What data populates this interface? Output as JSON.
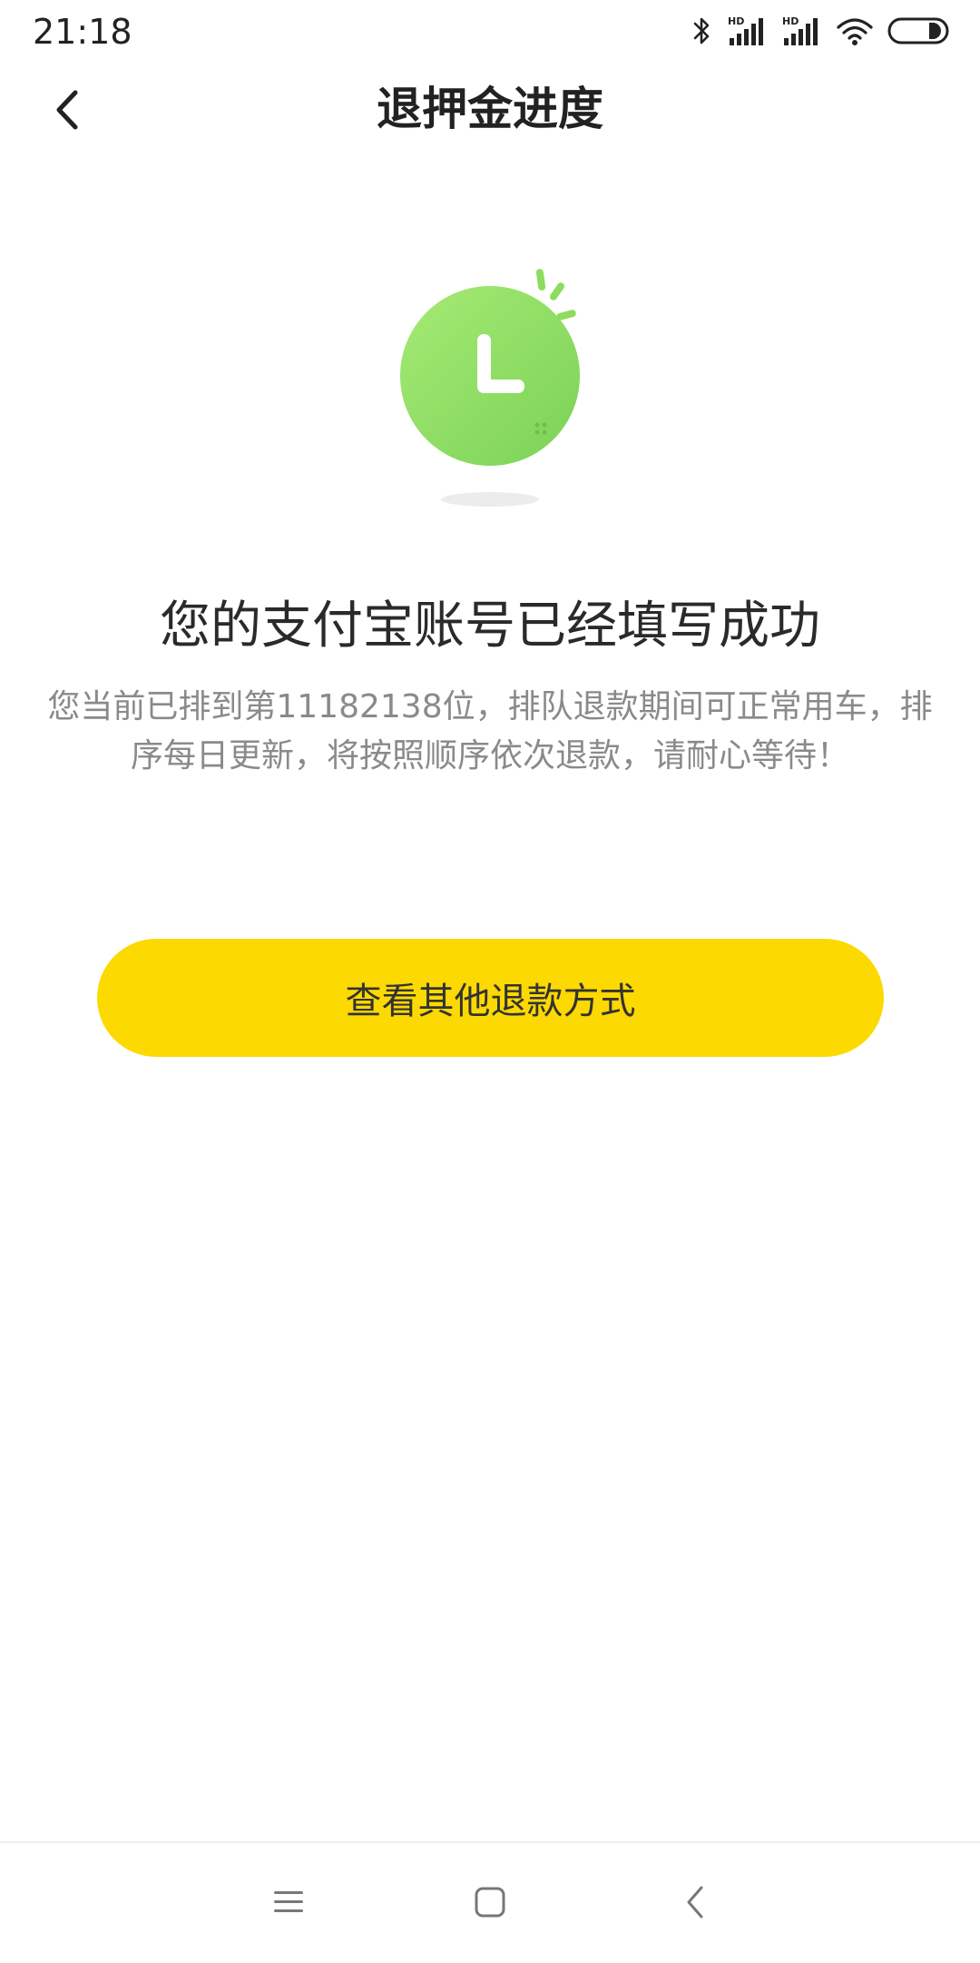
{
  "status_bar": {
    "time": "21:18",
    "icons": [
      "bluetooth-icon",
      "signal-hd-icon",
      "signal-hd-icon",
      "wifi-icon",
      "battery-icon"
    ]
  },
  "header": {
    "title": "退押金进度",
    "back_icon": "chevron-left-icon"
  },
  "illustration": {
    "icon": "clock-icon",
    "color": "#8edc5e"
  },
  "message": {
    "title": "您的支付宝账号已经填写成功",
    "body": "您当前已排到第11182138位，排队退款期间可正常用车，排序每日更新，将按照顺序依次退款，请耐心等待！"
  },
  "actions": {
    "other_refund_label": "查看其他退款方式",
    "button_color": "#fcd900"
  },
  "nav_bar": {
    "items": [
      "menu-icon",
      "home-square-icon",
      "back-triangle-icon"
    ]
  }
}
